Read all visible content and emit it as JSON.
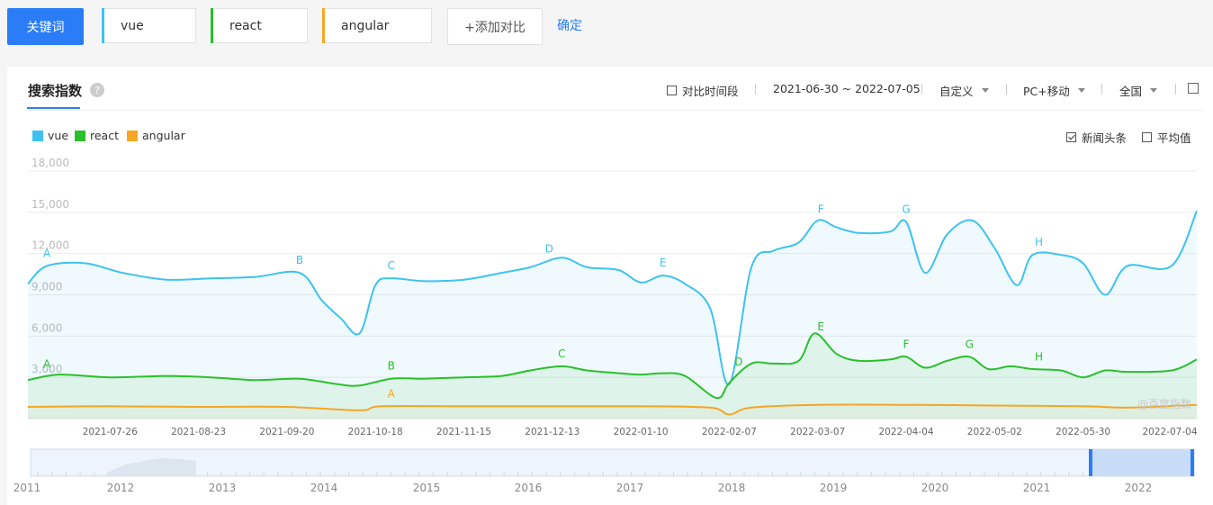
{
  "toolbar": {
    "keyword_label": "关键词",
    "keywords": [
      {
        "value": "vue",
        "color": "#3ec2f0"
      },
      {
        "value": "react",
        "color": "#2bbf2b"
      },
      {
        "value": "angular",
        "color": "#f5a623"
      }
    ],
    "add_compare_label": "+添加对比",
    "confirm_label": "确定"
  },
  "panel": {
    "tab_title": "搜索指数",
    "help_icon": "?",
    "compare_period_label": "对比时间段",
    "date_range": "2021-06-30 ~ 2022-07-05",
    "custom_label": "自定义",
    "device_label": "PC+移动",
    "region_label": "全国",
    "news_label": "新闻头条",
    "average_label": "平均值",
    "watermark": "@百度指数"
  },
  "chart_data": {
    "type": "area",
    "ylim": [
      0,
      18000
    ],
    "y_ticks": [
      "18,000",
      "15,000",
      "12,000",
      "9,000",
      "6,000",
      "3,000"
    ],
    "x_ticks": [
      "2021-07-26",
      "2021-08-23",
      "2021-09-20",
      "2021-10-18",
      "2021-11-15",
      "2021-12-13",
      "2022-01-10",
      "2022-02-07",
      "2022-03-07",
      "2022-04-04",
      "2022-05-02",
      "2022-05-30",
      "2022-07-04"
    ],
    "x_start": "2021-06-30",
    "x_end": "2022-07-05",
    "series": [
      {
        "name": "vue",
        "color": "#3ec2f0",
        "x": [
          "2021-06-30",
          "2021-07-06",
          "2021-07-18",
          "2021-07-30",
          "2021-08-13",
          "2021-08-27",
          "2021-09-10",
          "2021-09-24",
          "2021-10-01",
          "2021-10-07",
          "2021-10-13",
          "2021-10-18",
          "2021-10-23",
          "2021-11-02",
          "2021-11-15",
          "2021-11-27",
          "2021-12-06",
          "2021-12-16",
          "2021-12-24",
          "2022-01-03",
          "2022-01-10",
          "2022-01-17",
          "2022-01-24",
          "2022-02-01",
          "2022-02-07",
          "2022-02-14",
          "2022-02-21",
          "2022-03-01",
          "2022-03-07",
          "2022-03-13",
          "2022-03-20",
          "2022-03-30",
          "2022-04-04",
          "2022-04-10",
          "2022-04-17",
          "2022-04-25",
          "2022-05-02",
          "2022-05-09",
          "2022-05-14",
          "2022-05-23",
          "2022-05-30",
          "2022-06-06",
          "2022-06-13",
          "2022-06-27",
          "2022-07-05"
        ],
        "values": [
          9800,
          11100,
          11300,
          10600,
          10100,
          10200,
          10300,
          10600,
          8600,
          7300,
          6200,
          9700,
          10200,
          10000,
          10100,
          10600,
          11000,
          11700,
          11000,
          10800,
          9900,
          10400,
          9800,
          8000,
          2500,
          11000,
          12200,
          12800,
          14400,
          13900,
          13500,
          13600,
          14300,
          10600,
          13400,
          14400,
          12400,
          9700,
          11900,
          11900,
          11300,
          9000,
          11100,
          11100,
          15100
        ]
      },
      {
        "name": "react",
        "color": "#2bbf2b",
        "x": [
          "2021-06-30",
          "2021-07-10",
          "2021-07-26",
          "2021-08-13",
          "2021-08-27",
          "2021-09-10",
          "2021-09-24",
          "2021-10-06",
          "2021-10-13",
          "2021-10-23",
          "2021-11-02",
          "2021-11-15",
          "2021-11-27",
          "2021-12-06",
          "2021-12-16",
          "2021-12-24",
          "2022-01-03",
          "2022-01-10",
          "2022-01-17",
          "2022-01-24",
          "2022-02-03",
          "2022-02-07",
          "2022-02-14",
          "2022-02-21",
          "2022-03-01",
          "2022-03-06",
          "2022-03-13",
          "2022-03-20",
          "2022-03-30",
          "2022-04-04",
          "2022-04-10",
          "2022-04-17",
          "2022-04-24",
          "2022-04-30",
          "2022-05-07",
          "2022-05-14",
          "2022-05-23",
          "2022-05-30",
          "2022-06-06",
          "2022-06-13",
          "2022-06-27",
          "2022-07-05"
        ],
        "values": [
          2800,
          3200,
          3000,
          3100,
          3000,
          2800,
          2900,
          2500,
          2400,
          2900,
          2900,
          3000,
          3100,
          3500,
          3800,
          3500,
          3300,
          3200,
          3300,
          3100,
          1500,
          2600,
          4000,
          4000,
          4200,
          6200,
          4700,
          4200,
          4300,
          4500,
          3700,
          4200,
          4500,
          3600,
          3800,
          3600,
          3500,
          3000,
          3500,
          3400,
          3500,
          4300
        ]
      },
      {
        "name": "angular",
        "color": "#f5a623",
        "x": [
          "2021-06-30",
          "2021-07-26",
          "2021-08-23",
          "2021-09-20",
          "2021-10-13",
          "2021-10-20",
          "2021-11-15",
          "2021-12-13",
          "2022-01-10",
          "2022-02-01",
          "2022-02-07",
          "2022-02-14",
          "2022-03-07",
          "2022-04-04",
          "2022-05-02",
          "2022-05-30",
          "2022-06-13",
          "2022-07-05"
        ],
        "values": [
          850,
          900,
          850,
          850,
          600,
          900,
          900,
          900,
          900,
          800,
          300,
          800,
          1000,
          1000,
          950,
          900,
          800,
          1000
        ]
      }
    ],
    "annotations": [
      {
        "series": "vue",
        "labels": [
          "A",
          "B",
          "C",
          "D",
          "E",
          "F",
          "G",
          "H"
        ],
        "x": [
          "2021-07-06",
          "2021-09-24",
          "2021-10-23",
          "2021-12-12",
          "2022-01-17",
          "2022-03-08",
          "2022-04-04",
          "2022-05-16"
        ]
      },
      {
        "series": "react",
        "labels": [
          "A",
          "B",
          "C",
          "D",
          "E",
          "F",
          "G",
          "H"
        ],
        "x": [
          "2021-07-06",
          "2021-10-23",
          "2021-12-16",
          "2022-02-10",
          "2022-03-08",
          "2022-04-04",
          "2022-04-24",
          "2022-05-16"
        ]
      },
      {
        "series": "angular",
        "labels": [
          "A"
        ],
        "x": [
          "2021-10-23"
        ]
      }
    ],
    "overview_years": [
      "2011",
      "2012",
      "2013",
      "2014",
      "2015",
      "2016",
      "2017",
      "2018",
      "2019",
      "2020",
      "2021",
      "2022"
    ]
  }
}
